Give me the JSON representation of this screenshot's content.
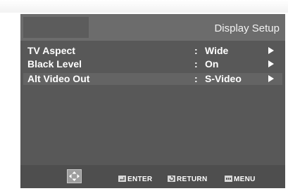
{
  "screen": {
    "title": "Display Setup"
  },
  "settings": [
    {
      "label": "TV Aspect",
      "separator": ":",
      "value": "Wide"
    },
    {
      "label": "Black Level",
      "separator": ":",
      "value": "On"
    },
    {
      "label": "Alt Video Out",
      "separator": ":",
      "value": "S-Video"
    }
  ],
  "footer": {
    "enter_label": "ENTER",
    "return_label": "RETURN",
    "menu_label": "MENU"
  },
  "colors": {
    "panel": "#585858",
    "header": "#6c6c6c",
    "selected_row": "#646464",
    "footer": "#4e4e4e",
    "text": "#ffffff"
  },
  "icons": {
    "nav": "direction-pad-icon",
    "enter": "enter-icon",
    "return": "return-icon",
    "menu": "menu-icon",
    "row_arrow": "arrow-right-icon"
  }
}
